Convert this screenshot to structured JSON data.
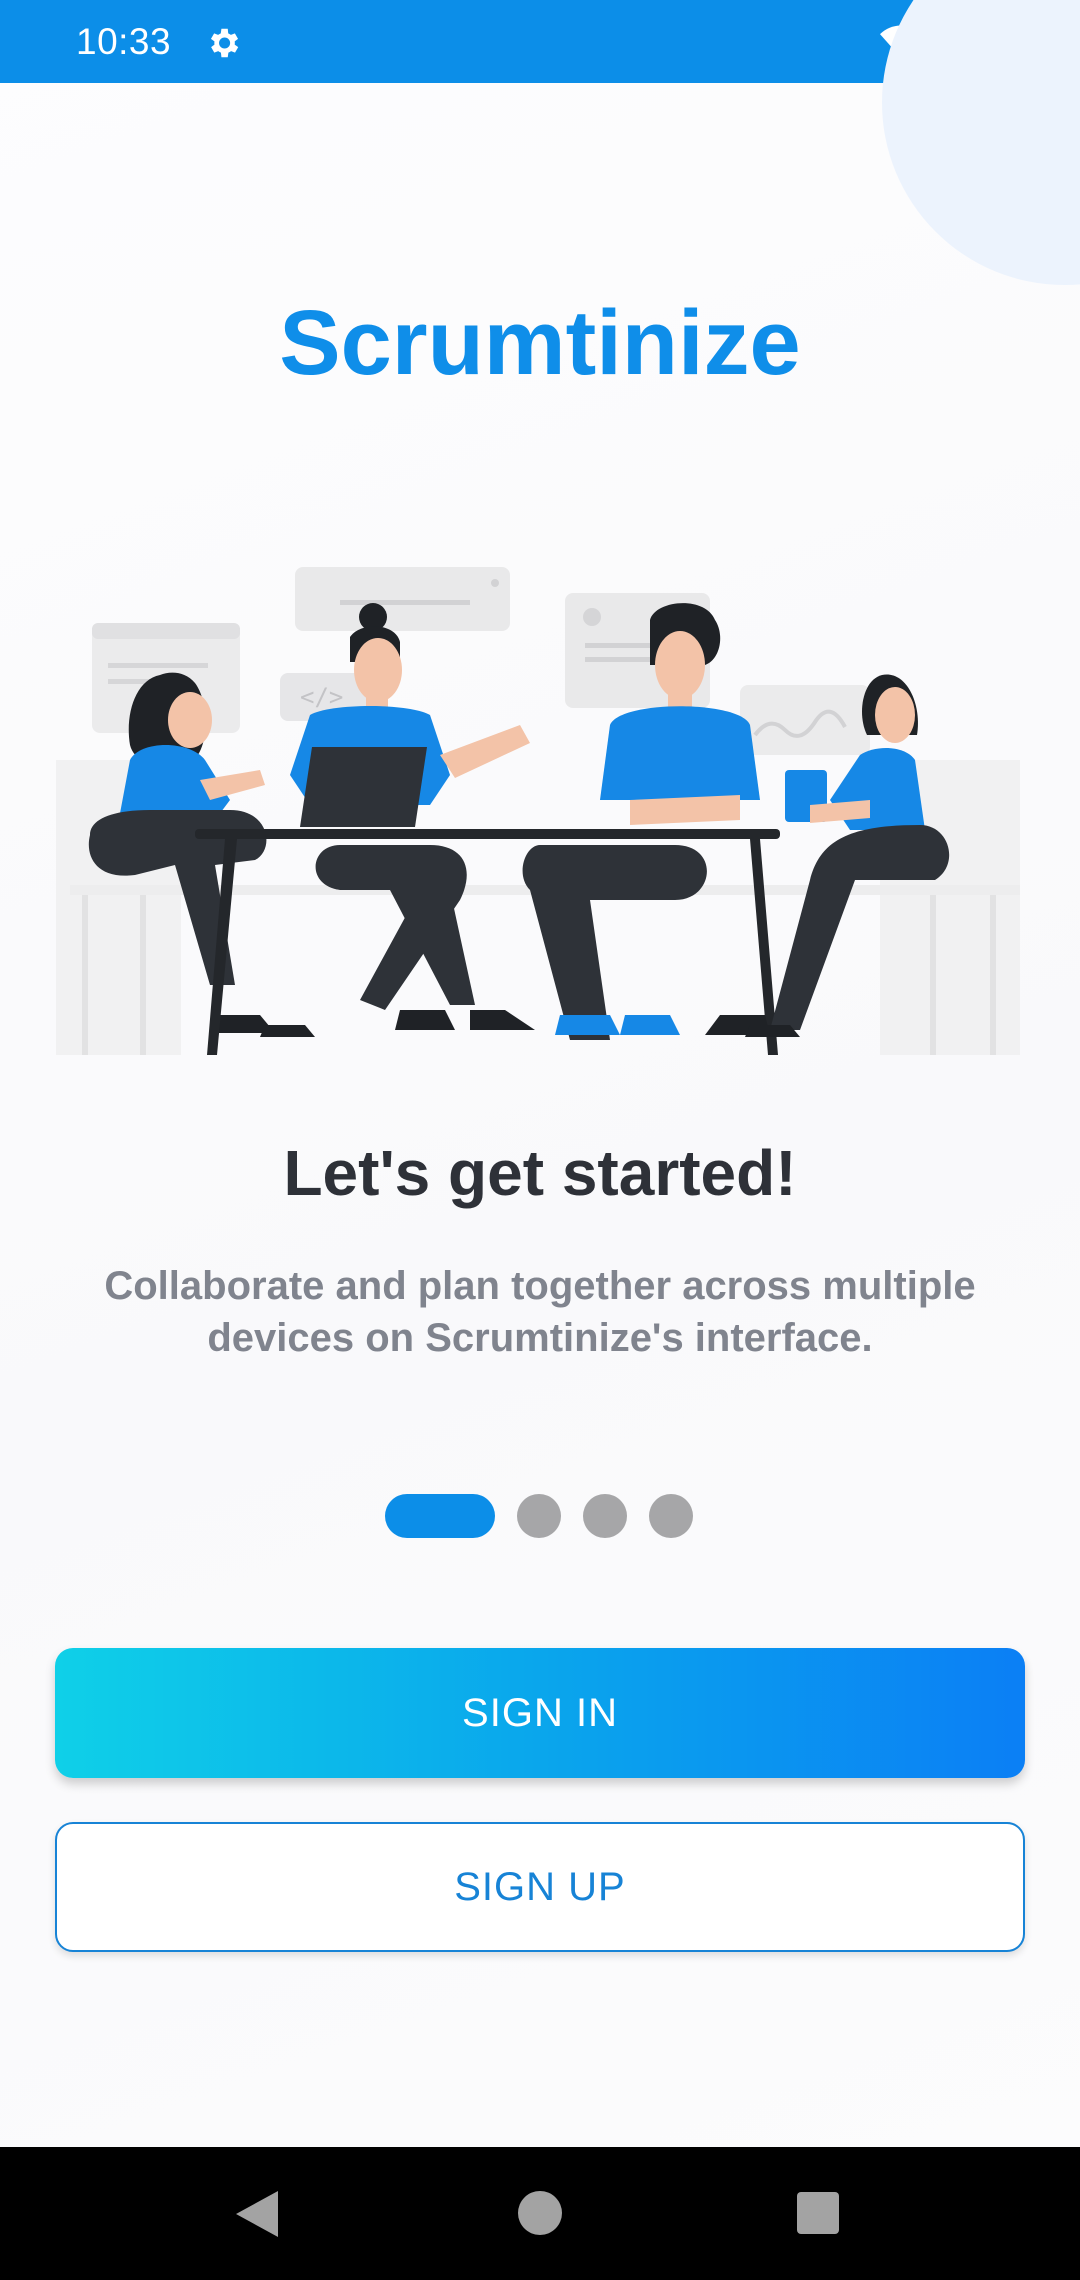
{
  "status_bar": {
    "time": "10:33",
    "icons": [
      "gear-icon",
      "wifi-icon",
      "signal-icon",
      "battery-icon"
    ],
    "color": "#0c8ee8"
  },
  "app": {
    "title": "Scrumtinize"
  },
  "onboarding": {
    "heading": "Let's get started!",
    "description": "Collaborate and plan together across multiple devices on Scrumtinize's interface.",
    "illustration": "team-meeting-illustration",
    "page_indicator": {
      "total": 4,
      "active_index": 0
    }
  },
  "actions": {
    "sign_in_label": "SIGN IN",
    "sign_up_label": "SIGN UP"
  },
  "nav_bar": {
    "icons": [
      "back-icon",
      "home-icon",
      "recents-icon"
    ]
  },
  "colors": {
    "accent": "#0f8ee9",
    "heading": "#2e3138",
    "body_text": "#80848e",
    "dot_inactive": "#a6a6a8",
    "gradient_start": "#0fd0e8",
    "gradient_end": "#0b7ff5"
  }
}
